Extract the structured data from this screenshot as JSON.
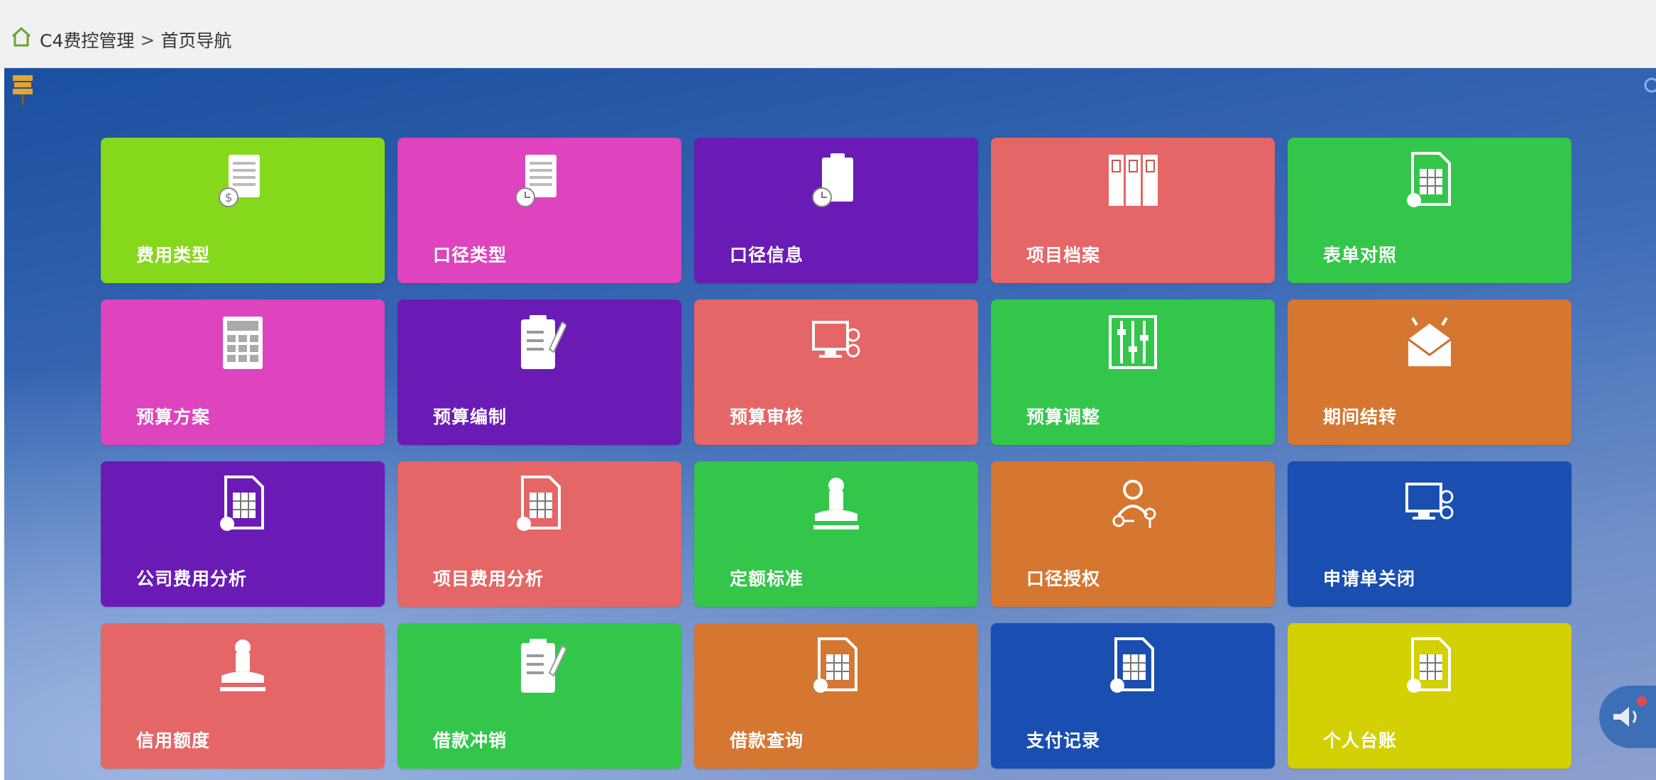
{
  "breadcrumb": {
    "items": [
      "C4费控管理",
      "首页导航"
    ],
    "separator": ">"
  },
  "tiles": [
    {
      "label": "费用类型",
      "color": "#85d81c",
      "icon": "document-coin-icon"
    },
    {
      "label": "口径类型",
      "color": "#dd44be",
      "icon": "document-clock-icon"
    },
    {
      "label": "口径信息",
      "color": "#6a1bb5",
      "icon": "clipboard-clock-icon"
    },
    {
      "label": "项目档案",
      "color": "#e56666",
      "icon": "archive-binders-icon"
    },
    {
      "label": "表单对照",
      "color": "#33c64b",
      "icon": "spreadsheet-icon"
    },
    {
      "label": "预算方案",
      "color": "#dd44be",
      "icon": "calculator-icon"
    },
    {
      "label": "预算编制",
      "color": "#6a1bb5",
      "icon": "clipboard-pen-icon"
    },
    {
      "label": "预算审核",
      "color": "#e56666",
      "icon": "monitor-user-icon"
    },
    {
      "label": "预算调整",
      "color": "#33c64b",
      "icon": "sliders-icon"
    },
    {
      "label": "期间结转",
      "color": "#d57731",
      "icon": "envelope-icon"
    },
    {
      "label": "公司费用分析",
      "color": "#6a1bb5",
      "icon": "spreadsheet-icon"
    },
    {
      "label": "项目费用分析",
      "color": "#e56666",
      "icon": "spreadsheet-icon"
    },
    {
      "label": "定额标准",
      "color": "#33c64b",
      "icon": "stamp-icon"
    },
    {
      "label": "口径授权",
      "color": "#d57731",
      "icon": "user-key-icon"
    },
    {
      "label": "申请单关闭",
      "color": "#1a4fb1",
      "icon": "monitor-user-icon"
    },
    {
      "label": "信用额度",
      "color": "#e56666",
      "icon": "stamp-icon"
    },
    {
      "label": "借款冲销",
      "color": "#33c64b",
      "icon": "clipboard-pen-icon"
    },
    {
      "label": "借款查询",
      "color": "#d57731",
      "icon": "spreadsheet-icon"
    },
    {
      "label": "支付记录",
      "color": "#1a4fb1",
      "icon": "spreadsheet-icon"
    },
    {
      "label": "个人台账",
      "color": "#d3d003",
      "icon": "spreadsheet-icon"
    }
  ]
}
